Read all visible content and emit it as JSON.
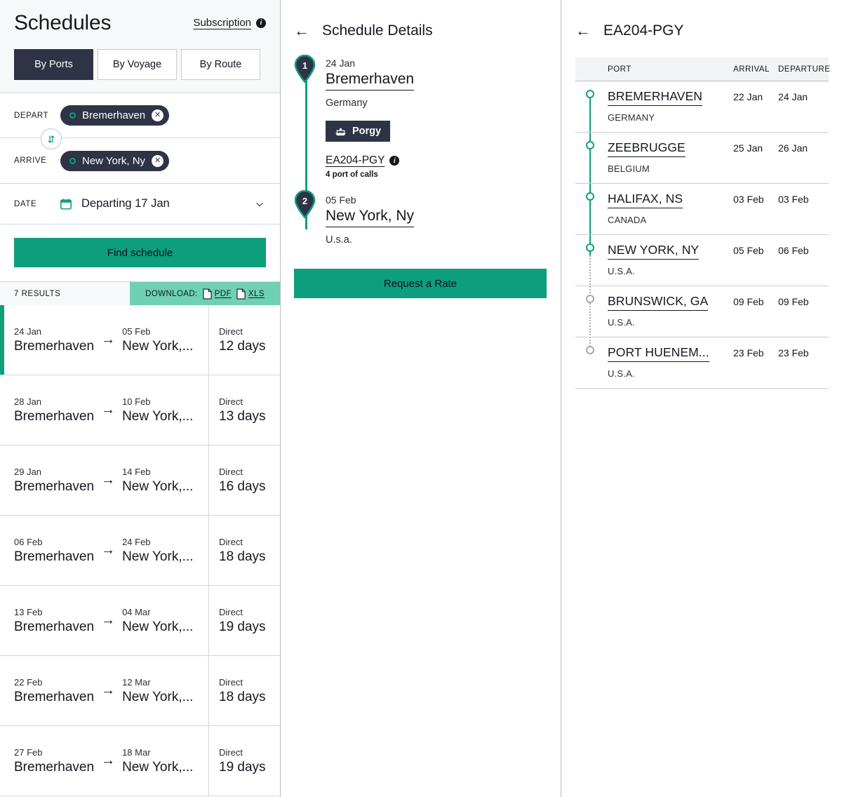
{
  "colors": {
    "accent_green": "#0d9e7d",
    "rail_green": "#0ba07e",
    "download_bg": "#6fd1b4",
    "dark_slate": "#2e3346",
    "inactive_gray": "#a7aab0"
  },
  "left": {
    "title": "Schedules",
    "subscription_label": "Subscription",
    "info_icon": "info-icon",
    "tabs": [
      {
        "label": "By Ports",
        "active": true
      },
      {
        "label": "By Voyage",
        "active": false
      },
      {
        "label": "By Route",
        "active": false
      }
    ],
    "depart": {
      "label": "DEPART",
      "value": "Bremerhaven",
      "remove_icon": "close-icon"
    },
    "arrive": {
      "label": "ARRIVE",
      "value": "New York, Ny",
      "remove_icon": "close-icon"
    },
    "swap_icon": "swap-vertical-icon",
    "date": {
      "label": "DATE",
      "value": "Departing 17 Jan",
      "calendar_icon": "calendar-icon",
      "chevron_icon": "chevron-down-icon"
    },
    "find_button": "Find schedule",
    "results_count": "7 RESULTS",
    "download_label": "DOWNLOAD:",
    "download_links": [
      {
        "label": "PDF",
        "icon": "file-icon"
      },
      {
        "label": "XLS",
        "icon": "file-icon"
      }
    ],
    "results": [
      {
        "dep_date": "24 Jan",
        "dep_port": "Bremerhaven",
        "arr_date": "05 Feb",
        "arr_port": "New York,...",
        "type": "Direct",
        "duration": "12 days",
        "selected": true
      },
      {
        "dep_date": "28 Jan",
        "dep_port": "Bremerhaven",
        "arr_date": "10 Feb",
        "arr_port": "New York,...",
        "type": "Direct",
        "duration": "13 days",
        "selected": false
      },
      {
        "dep_date": "29 Jan",
        "dep_port": "Bremerhaven",
        "arr_date": "14 Feb",
        "arr_port": "New York,...",
        "type": "Direct",
        "duration": "16 days",
        "selected": false
      },
      {
        "dep_date": "06 Feb",
        "dep_port": "Bremerhaven",
        "arr_date": "24 Feb",
        "arr_port": "New York,...",
        "type": "Direct",
        "duration": "18 days",
        "selected": false
      },
      {
        "dep_date": "13 Feb",
        "dep_port": "Bremerhaven",
        "arr_date": "04 Mar",
        "arr_port": "New York,...",
        "type": "Direct",
        "duration": "19 days",
        "selected": false
      },
      {
        "dep_date": "22 Feb",
        "dep_port": "Bremerhaven",
        "arr_date": "12 Mar",
        "arr_port": "New York,...",
        "type": "Direct",
        "duration": "18 days",
        "selected": false
      },
      {
        "dep_date": "27 Feb",
        "dep_port": "Bremerhaven",
        "arr_date": "18 Mar",
        "arr_port": "New York,...",
        "type": "Direct",
        "duration": "19 days",
        "selected": false
      }
    ]
  },
  "middle": {
    "back_icon": "back-arrow-icon",
    "title": "Schedule Details",
    "stop1": {
      "number": "1",
      "date": "24 Jan",
      "port": "Bremerhaven",
      "country": "Germany",
      "vessel": "Porgy",
      "vessel_icon": "ship-icon",
      "voyage_code": "EA204-PGY",
      "voyage_info_icon": "info-icon",
      "port_calls": "4 port of calls"
    },
    "stop2": {
      "number": "2",
      "date": "05 Feb",
      "port": "New York, Ny",
      "country": "U.s.a."
    },
    "request_rate_button": "Request a Rate"
  },
  "right": {
    "back_icon": "back-arrow-icon",
    "title": "EA204-PGY",
    "columns": {
      "port": "PORT",
      "arrival": "ARRIVAL",
      "departure": "DEPARTURE"
    },
    "rows": [
      {
        "port": "BREMERHAVEN",
        "country": "GERMANY",
        "arrival": "22 Jan",
        "departure": "24 Jan",
        "active": true
      },
      {
        "port": "ZEEBRUGGE",
        "country": "BELGIUM",
        "arrival": "25 Jan",
        "departure": "26 Jan",
        "active": true
      },
      {
        "port": "HALIFAX, NS",
        "country": "CANADA",
        "arrival": "03 Feb",
        "departure": "03 Feb",
        "active": true
      },
      {
        "port": "NEW YORK, NY",
        "country": "U.S.A.",
        "arrival": "05 Feb",
        "departure": "06 Feb",
        "active": true
      },
      {
        "port": "BRUNSWICK, GA",
        "country": "U.S.A.",
        "arrival": "09 Feb",
        "departure": "09 Feb",
        "active": false
      },
      {
        "port": "PORT HUENEM...",
        "country": "U.S.A.",
        "arrival": "23 Feb",
        "departure": "23 Feb",
        "active": false
      }
    ]
  }
}
